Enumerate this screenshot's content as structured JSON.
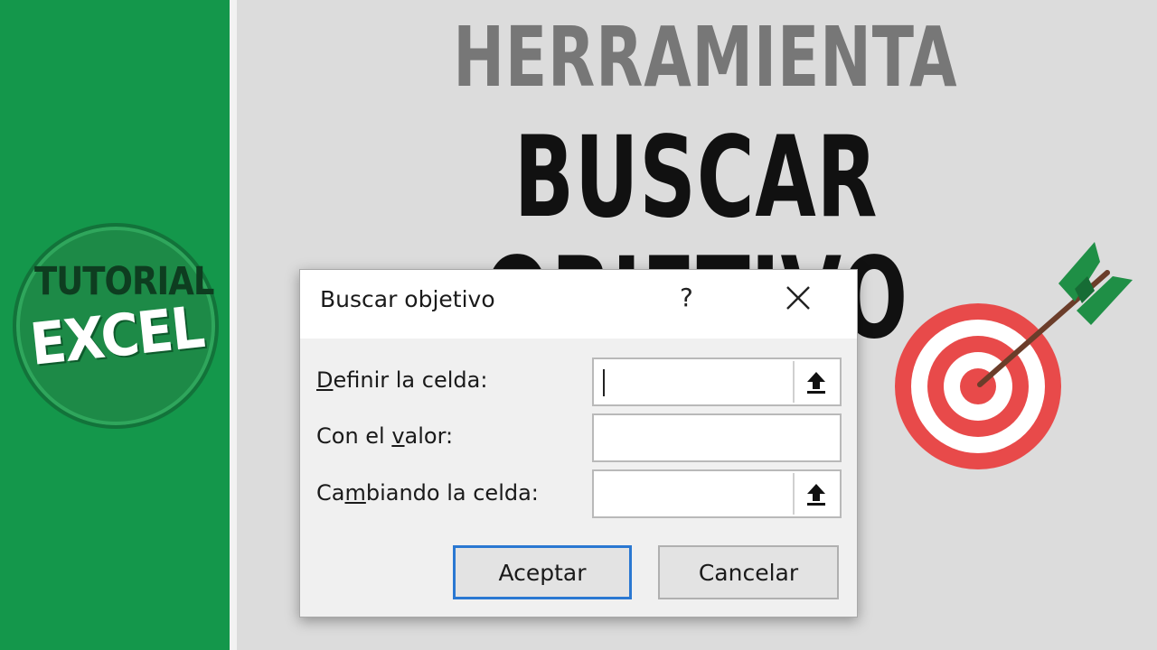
{
  "branding": {
    "badge_line1": "TUTORIAL",
    "badge_line2": "EXCEL",
    "accent_color": "#14974b"
  },
  "heading": {
    "line1": "HERRAMIENTA",
    "line2": "BUSCAR OBJETIVO"
  },
  "dialog": {
    "title": "Buscar objetivo",
    "help_label": "?",
    "fields": [
      {
        "label_pre": "",
        "label_ul": "D",
        "label_post": "efinir la celda:",
        "value": "",
        "has_ref_button": true
      },
      {
        "label_pre": "Con el ",
        "label_ul": "v",
        "label_post": "alor:",
        "value": "",
        "has_ref_button": false
      },
      {
        "label_pre": "Ca",
        "label_ul": "m",
        "label_post": "biando la celda:",
        "value": "",
        "has_ref_button": true
      }
    ],
    "ok_label": "Aceptar",
    "cancel_label": "Cancelar"
  },
  "icons": [
    "help-icon",
    "close-icon",
    "collapse-dialog-icon",
    "target-icon"
  ]
}
